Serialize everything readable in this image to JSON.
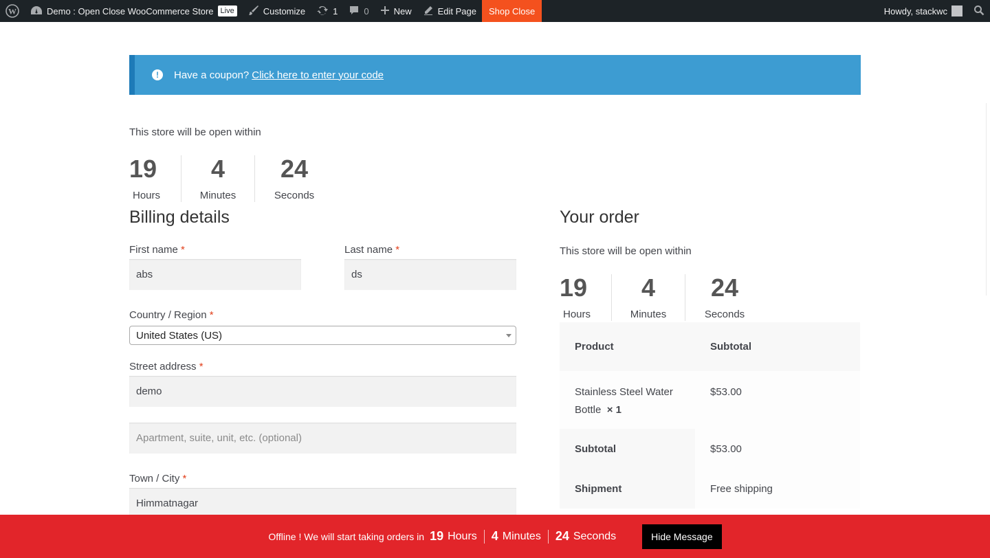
{
  "adminbar": {
    "site_name": "Demo : Open Close WooCommerce Store",
    "live_badge": "Live",
    "customize_label": "Customize",
    "updates_count": "1",
    "comments_count": "0",
    "new_label": "New",
    "edit_page_label": "Edit Page",
    "shop_close_label": "Shop Close",
    "howdy_label": "Howdy, stackwc"
  },
  "coupon": {
    "prompt": "Have a coupon?",
    "link": "Click here to enter your code"
  },
  "top_countdown": {
    "heading": "This store will be open within",
    "hours": "19",
    "hours_label": "Hours",
    "minutes": "4",
    "minutes_label": "Minutes",
    "seconds": "24",
    "seconds_label": "Seconds"
  },
  "billing": {
    "title": "Billing details",
    "first_name_label": "First name",
    "first_name_value": "abs",
    "last_name_label": "Last name",
    "last_name_value": "ds",
    "country_label": "Country / Region",
    "country_value": "United States (US)",
    "street_label": "Street address",
    "street_value": "demo",
    "apartment_placeholder": "Apartment, suite, unit, etc. (optional)",
    "city_label": "Town / City",
    "city_value": "Himmatnagar",
    "required_mark": "*"
  },
  "order": {
    "title": "Your order",
    "countdown_heading": "This store will be open within",
    "hours": "19",
    "hours_label": "Hours",
    "minutes": "4",
    "minutes_label": "Minutes",
    "seconds": "24",
    "seconds_label": "Seconds",
    "col_product": "Product",
    "col_subtotal": "Subtotal",
    "item_name": "Stainless Steel Water Bottle",
    "item_qty": "× 1",
    "item_price": "$53.00",
    "subtotal_label": "Subtotal",
    "subtotal_value": "$53.00",
    "shipment_label": "Shipment",
    "shipment_value": "Free shipping"
  },
  "bottombar": {
    "message": "Offline ! We will start taking orders in",
    "hours": "19",
    "hours_label": "Hours",
    "minutes": "4",
    "minutes_label": "Minutes",
    "seconds": "24",
    "seconds_label": "Seconds",
    "hide_button": "Hide Message"
  },
  "colors": {
    "adminbar_bg": "#1d2327",
    "shop_close_bg": "#f4511e",
    "coupon_bg": "#3d9cd2",
    "bottombar_bg": "#e2252a",
    "required": "#e2401c"
  }
}
